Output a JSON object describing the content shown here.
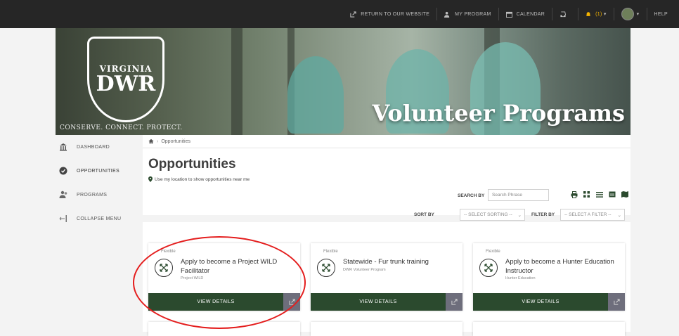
{
  "topbar": {
    "links": [
      {
        "label": "RETURN TO OUR WEBSITE",
        "icon": "external-link-icon"
      },
      {
        "label": "MY PROGRAM",
        "icon": "people-icon"
      },
      {
        "label": "CALENDAR",
        "icon": "calendar-icon"
      }
    ],
    "notifications_count": "(1)",
    "help": "HELP"
  },
  "hero": {
    "logo_line1": "VIRGINIA",
    "logo_line2": "DWR",
    "tagline": "CONSERVE. CONNECT. PROTECT.",
    "title": "Volunteer Programs"
  },
  "sidebar": {
    "items": [
      {
        "label": "DASHBOARD",
        "icon": "bank-icon"
      },
      {
        "label": "OPPORTUNITIES",
        "icon": "check-circle-icon"
      },
      {
        "label": "PROGRAMS",
        "icon": "people-icon"
      },
      {
        "label": "COLLAPSE MENU",
        "icon": "collapse-arrow-icon"
      }
    ]
  },
  "breadcrumb": {
    "home_icon": "home-icon",
    "current": "Opportunities"
  },
  "page": {
    "title": "Opportunities",
    "location_link": "Use my location to show opportunities near me"
  },
  "filters": {
    "search_label": "SEARCH BY",
    "search_placeholder": "Search Phrase",
    "sort_label": "SORT BY",
    "sort_value": "-- SELECT SORTING --",
    "filter_label": "FILTER BY",
    "filter_value": "-- SELECT A FILTER --"
  },
  "view_modes": [
    "print-icon",
    "grid-icon",
    "list-icon",
    "calendar-icon",
    "map-icon"
  ],
  "cards": [
    {
      "type": "Flexible",
      "title_line1": "Apply to become a Project WILD",
      "title_line2": "Facilitator",
      "program": "Project WILD",
      "button": "VIEW DETAILS"
    },
    {
      "type": "Flexible",
      "title_line1": "Statewide - Fur trunk training",
      "title_line2": "",
      "program": "DWR Volunteer Program",
      "button": "VIEW DETAILS"
    },
    {
      "type": "Flexible",
      "title_line1": "Apply to become a Hunter Education",
      "title_line2": "Instructor",
      "program": "Hunter Education",
      "button": "VIEW DETAILS"
    }
  ],
  "colors": {
    "topbar": "#262626",
    "button_green": "#2b4a2e",
    "highlight": "#e41d1d"
  }
}
